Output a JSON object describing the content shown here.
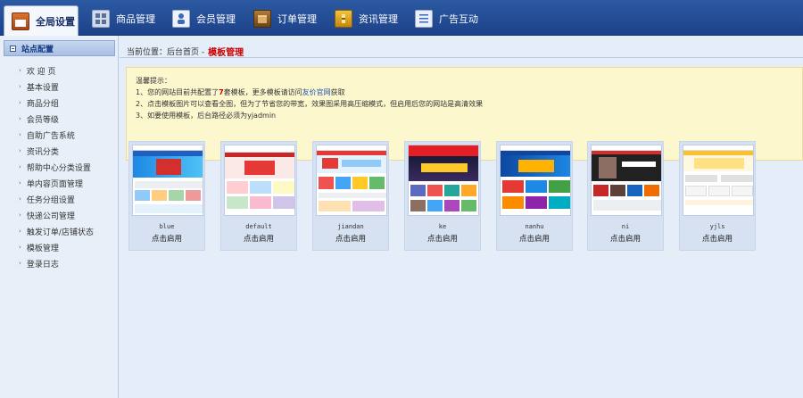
{
  "topnav": {
    "tabs": [
      {
        "label": "全局设置",
        "icon": "global-settings-icon",
        "active": true
      },
      {
        "label": "商品管理",
        "icon": "goods-grid-icon"
      },
      {
        "label": "会员管理",
        "icon": "member-card-icon"
      },
      {
        "label": "订单管理",
        "icon": "order-box-icon"
      },
      {
        "label": "资讯管理",
        "icon": "news-folder-icon"
      },
      {
        "label": "广告互动",
        "icon": "ad-document-icon"
      }
    ]
  },
  "sidebar": {
    "heading": "站点配置",
    "items": [
      {
        "label": "欢 迎 页"
      },
      {
        "label": "基本设置"
      },
      {
        "label": "商品分组"
      },
      {
        "label": "会员等级"
      },
      {
        "label": "自助广告系统"
      },
      {
        "label": "资讯分类"
      },
      {
        "label": "帮助中心分类设置"
      },
      {
        "label": "单内容页面管理"
      },
      {
        "label": "任务分组设置"
      },
      {
        "label": "快递公司管理"
      },
      {
        "label": "触发订单/店铺状态"
      },
      {
        "label": "模板管理"
      },
      {
        "label": "登录日志"
      }
    ]
  },
  "breadcrumb": {
    "prefix": "当前位置：后台首页 -",
    "current": "模板管理"
  },
  "tips": {
    "title": "温馨提示：",
    "line1_a": "1、您的网站目前共配置了",
    "line1_count": "7",
    "line1_b": "套模板，更多模板请访问",
    "line1_link": "友价官网",
    "line1_c": "获取",
    "line2": "2、点击模板图片可以查看全图，但为了节省您的带宽，效果图采用高压缩模式，但启用后您的网站是高清效果",
    "line3": "3、如要使用模板，后台路径必须为yjadmin"
  },
  "templates": [
    {
      "name": "blue",
      "action": "点击启用"
    },
    {
      "name": "default",
      "action": "点击启用"
    },
    {
      "name": "jiandan",
      "action": "点击启用"
    },
    {
      "name": "ke",
      "action": "点击启用"
    },
    {
      "name": "nanhu",
      "action": "点击启用"
    },
    {
      "name": "ni",
      "action": "点击启用"
    },
    {
      "name": "yjls",
      "action": "点击启用"
    }
  ],
  "colors": {
    "nav_bg": "#1c4289",
    "highlight_red": "#cc0000",
    "tips_bg": "#fdf7cd",
    "link_blue": "#1f4fb8"
  }
}
